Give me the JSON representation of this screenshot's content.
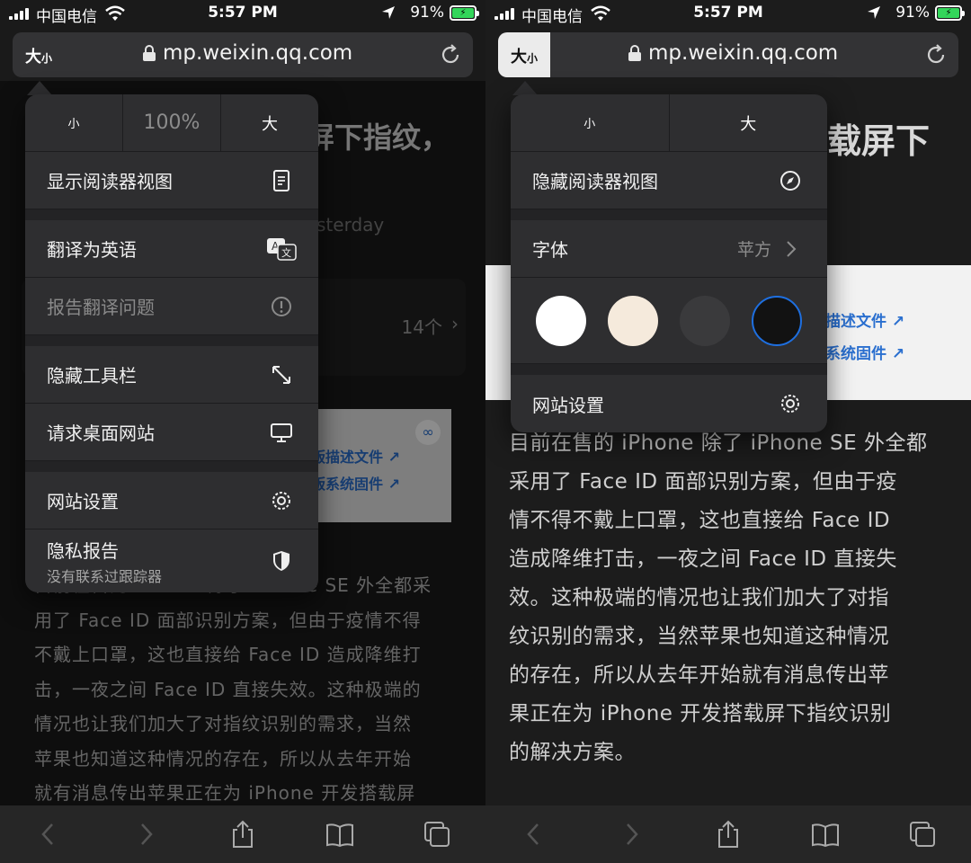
{
  "status_bar": {
    "carrier": "中国电信",
    "time": "5:57 PM",
    "battery_pct": "91%"
  },
  "address_bar": {
    "aa_big": "大",
    "aa_small": "小",
    "url": "mp.weixin.qq.com"
  },
  "left": {
    "bg_title": "屏下指纹，",
    "bg_meta": "sterday",
    "bg_count": "14个",
    "bg_links": [
      "版描述文件 ↗",
      "版系统固件 ↗"
    ],
    "bg_paragraph": [
      "目前在售的 iPhone 除了 iPhone SE 外全都采",
      "用了 Face ID 面部识别方案，但由于疫情不得",
      "不戴上口罩，这也直接给 Face ID 造成降维打",
      "击，一夜之间 Face ID 直接失效。这种极端的",
      "情况也让我们加大了对指纹识别的需求，当然",
      "苹果也知道这种情况的存在，所以从去年开始",
      "就有消息传出苹果正在为 iPhone 开发搭载屏"
    ],
    "menu": {
      "zoom_small": "小",
      "zoom_pct": "100%",
      "zoom_big": "大",
      "show_reader": "显示阅读器视图",
      "translate": "翻译为英语",
      "report_translation": "报告翻译问题",
      "hide_toolbar": "隐藏工具栏",
      "request_desktop": "请求桌面网站",
      "website_settings": "网站设置",
      "privacy_report": "隐私报告",
      "privacy_sub": "没有联系过跟踪器"
    }
  },
  "right": {
    "bg_title": "载屏下",
    "bg_links": [
      "描述文件 ↗",
      "系统固件 ↗"
    ],
    "paragraph": [
      "目前在售的 iPhone 除了 iPhone SE 外全都",
      "采用了 Face ID 面部识别方案，但由于疫",
      "情不得不戴上口罩，这也直接给 Face ID",
      "造成降维打击，一夜之间 Face ID 直接失",
      "效。这种极端的情况也让我们加大了对指",
      "纹识别的需求，当然苹果也知道这种情况",
      "的存在，所以从去年开始就有消息传出苹",
      "果正在为 iPhone 开发搭载屏下指纹识别",
      "的解决方案。"
    ],
    "menu": {
      "zoom_small": "小",
      "zoom_big": "大",
      "hide_reader": "隐藏阅读器视图",
      "font_label": "字体",
      "font_value": "苹方",
      "website_settings": "网站设置"
    },
    "swatches": [
      "#ffffff",
      "#f5eadc",
      "#3a3a3c",
      "#121212"
    ]
  }
}
